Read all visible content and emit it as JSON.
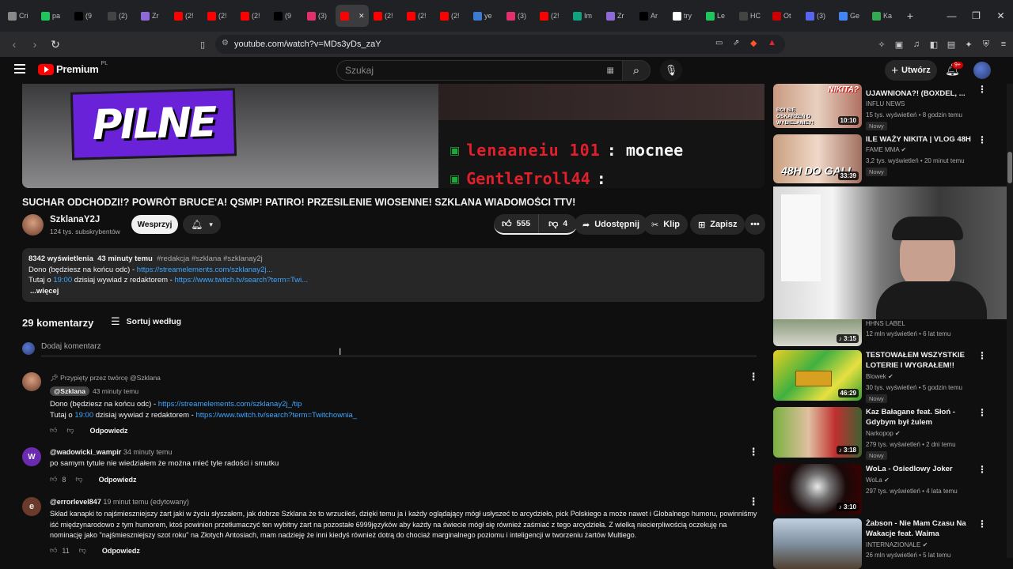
{
  "browser": {
    "tabs": [
      {
        "label": "Cri",
        "color": "#888888"
      },
      {
        "label": "pa",
        "color": "#1ec65c"
      },
      {
        "label": "(9",
        "color": "#000000"
      },
      {
        "label": "(2)",
        "color": "#444444"
      },
      {
        "label": "Zr",
        "color": "#8e6ad8"
      },
      {
        "label": "(2!",
        "color": "#ff0000"
      },
      {
        "label": "(2!",
        "color": "#ff0000"
      },
      {
        "label": "(2!",
        "color": "#ff0000"
      },
      {
        "label": "(9",
        "color": "#000000"
      },
      {
        "label": "(3)",
        "color": "#e1306c"
      },
      {
        "label": "",
        "color": "#ff0000",
        "active": true
      },
      {
        "label": "(2!",
        "color": "#ff0000"
      },
      {
        "label": "(2!",
        "color": "#ff0000"
      },
      {
        "label": "(2!",
        "color": "#ff0000"
      },
      {
        "label": "ye",
        "color": "#3a7bd5"
      },
      {
        "label": "(3)",
        "color": "#e1306c"
      },
      {
        "label": "(2!",
        "color": "#ff0000"
      },
      {
        "label": "Im",
        "color": "#10a37f"
      },
      {
        "label": "Zr",
        "color": "#8e6ad8"
      },
      {
        "label": "Ar",
        "color": "#000000"
      },
      {
        "label": "try",
        "color": "#ffffff"
      },
      {
        "label": "Le",
        "color": "#1ec65c"
      },
      {
        "label": "HC",
        "color": "#444444"
      },
      {
        "label": "Ot",
        "color": "#cc0000"
      },
      {
        "label": "(3)",
        "color": "#5865f2"
      },
      {
        "label": "Ge",
        "color": "#4285f4"
      },
      {
        "label": "Ka",
        "color": "#34a853"
      }
    ],
    "url": "youtube.com/watch?v=MDs3yDs_zaY"
  },
  "header": {
    "logo_text": "Premium",
    "logo_region": "PL",
    "search_placeholder": "Szukaj",
    "create_label": "Utwórz",
    "notif_count": "9+"
  },
  "video": {
    "overlay_text": "PILNE",
    "chat_line1_name": "lenaaneiu 101",
    "chat_line1_msg": ": mocnee",
    "chat_line2_name": "GentleTroll44",
    "chat_line2_msg": ":",
    "title": "SUCHAR ODCHODZI!? POWRÓT BRUCE'A! QSMP! PATIRO! PRZESILENIE WIOSENNE! SZKLANA WIADOMOŚCI TTV!",
    "channel": "SzklanaY2J",
    "subscribers": "124 tys. subskrybentów",
    "support_label": "Wesprzyj",
    "likes": "555",
    "dislikes": "4",
    "share_label": "Udostępnij",
    "clip_label": "Klip",
    "save_label": "Zapisz"
  },
  "description": {
    "views": "8342 wyświetlenia",
    "age": "43 minuty temu",
    "tags": "#redakcja #szklana #szklanay2j",
    "line1_text": "Dono (będziesz na końcu odc) - ",
    "line1_link": "https://streamelements.com/szklanay2j...",
    "line2_pre": "Tutaj o ",
    "line2_time": "19:00",
    "line2_mid": " dzisiaj wywiad z redaktorem - ",
    "line2_link": "https://www.twitch.tv/search?term=Twi...",
    "more": "...więcej"
  },
  "comments": {
    "count_label": "29 komentarzy",
    "sort_label": "Sortuj według",
    "add_placeholder": "Dodaj komentarz",
    "reply_label": "Odpowiedz",
    "items": [
      {
        "pinned": "Przypięty przez twórcę @Szklana",
        "author": "@Szklana",
        "time": "43 minuty temu",
        "line1_text": "Dono (będziesz na końcu odc) - ",
        "line1_link": "https://streamelements.com/szklanay2j_/tip",
        "line2_pre": "Tutaj o ",
        "line2_time": "19:00",
        "line2_mid": " dzisiaj wywiad z redaktorem - ",
        "line2_link": "https://www.twitch.tv/search?term=Twitchownia_",
        "likes": ""
      },
      {
        "author": "@wadowicki_wampir",
        "time": "34 minuty temu",
        "avatar_letter": "W",
        "text": "po samym tytule nie wiedziałem że można mieć tyle radości i smutku",
        "likes": "8"
      },
      {
        "author": "@errorlevel847",
        "time": "19 minut temu (edytowany)",
        "avatar_letter": "e",
        "text": "Skład kanapki to najśmieszniejszy żart jaki w życiu słyszałem, jak dobrze Szklana że to wrzuciłeś, dzięki temu ja i każdy oglądający mógł usłyszeć to arcydzieło, pick Polskiego a może nawet i Globalnego humoru, powinniśmy iść międzynarodowo z tym humorem, ktoś powinien przetłumaczyć ten wybitny żart na pozostałe 6999języków aby każdy na świecie mógł się również zaśmiać z tego arcydzieła. Z wielką niecierpliwością oczekuję na nominację jako \"najśmieszniejszy szot roku\" na Złotych Antosiach, mam nadzieję że inni kiedyś również dotrą do chociaż marginalnego poziomu i inteligencji w tworzeniu żartów  Multiego.",
        "likes": "11"
      }
    ]
  },
  "sidebar": {
    "items": [
      {
        "title": "UJAWNIONA?! (BOXDEL, ...",
        "channel": "INFLU NEWS",
        "meta": "15 tys. wyświetleń • 8 godzin temu",
        "badge": "Nowy",
        "duration": "10:10",
        "thumb_text": "BOI SIĘ OSKARŻEŃ O WYBIELANIE?!",
        "thumb_top": "NIKITA?",
        "verified": false
      },
      {
        "title": "ILE WAŻY NIKITA | VLOG 48H",
        "channel": "FAME MMA",
        "meta": "3,2 tys. wyświetleń • 20 minut temu",
        "badge": "Nowy",
        "duration": "33:39",
        "thumb_text": "48H DO GALI",
        "verified": true
      },
      {
        "title": "",
        "channel": "HHNS LABEL",
        "meta": "12 mln wyświetleń • 6 lat temu",
        "badge": "",
        "duration": "3:15",
        "verified": false
      },
      {
        "title": "TESTOWAŁEM WSZYSTKIE LOTERIE I WYGRAŁEM!!",
        "channel": "Blowek",
        "meta": "30 tys. wyświetleń • 5 godzin temu",
        "badge": "Nowy",
        "duration": "46:29",
        "verified": true
      },
      {
        "title": "Kaz Bałagane feat. Słoń - Gdybym był żulem",
        "channel": "Narkopop",
        "meta": "279 tys. wyświetleń • 2 dni temu",
        "badge": "Nowy",
        "duration": "3:18",
        "verified": true
      },
      {
        "title": "WoLa - Osiedlowy Joker",
        "channel": "WoLa",
        "meta": "297 tys. wyświetleń • 4 lata temu",
        "badge": "",
        "duration": "3:10",
        "verified": true
      },
      {
        "title": "Żabson - Nie Mam Czasu Na Wakacje feat. Waima",
        "channel": "INTERNAZIONALE",
        "meta": "26 mln wyświetleń • 5 lat temu",
        "badge": "",
        "duration": "",
        "verified": true
      }
    ]
  },
  "colors": {
    "bg": "#0f0f0f",
    "link": "#3ea6ff",
    "brand_red": "#ff0000",
    "overlay_purple": "#6a22d8"
  }
}
